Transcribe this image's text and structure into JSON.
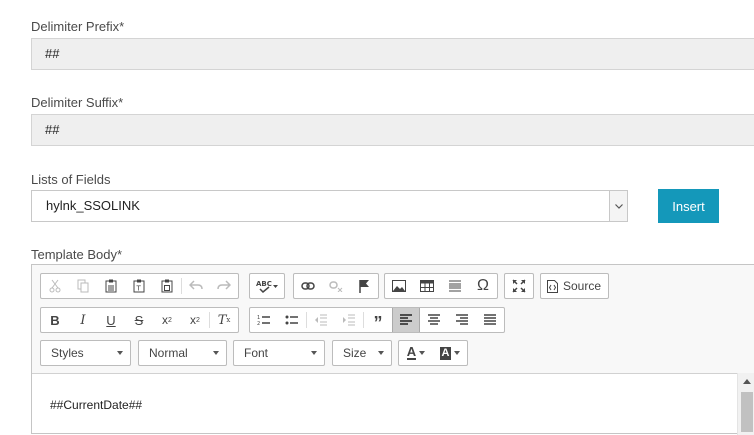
{
  "form": {
    "delimiter_prefix": {
      "label": "Delimiter Prefix*",
      "value": "##"
    },
    "delimiter_suffix": {
      "label": "Delimiter Suffix*",
      "value": "##"
    },
    "fields_list": {
      "label": "Lists of Fields",
      "selected": "hylnk_SSOLINK"
    },
    "insert_label": "Insert",
    "template_body": {
      "label": "Template Body*"
    }
  },
  "toolbar": {
    "source_label": "Source",
    "icons_row1": [
      "cut-icon",
      "copy-icon",
      "paste-icon",
      "paste-text-icon",
      "paste-word-icon",
      "undo-icon",
      "redo-icon",
      "spellcheck-icon",
      "link-icon",
      "unlink-icon",
      "anchor-icon",
      "image-icon",
      "table-icon",
      "horizontal-rule-icon",
      "special-char-icon",
      "maximize-icon",
      "source-icon"
    ],
    "icons_row2": [
      "bold-icon",
      "italic-icon",
      "underline-icon",
      "strikethrough-icon",
      "subscript-icon",
      "superscript-icon",
      "remove-format-icon",
      "numbered-list-icon",
      "bulleted-list-icon",
      "outdent-icon",
      "indent-icon",
      "blockquote-icon",
      "align-left-icon",
      "align-center-icon",
      "align-right-icon",
      "justify-icon"
    ],
    "styles_label": "Styles",
    "format_label": "Normal",
    "font_label": "Font",
    "size_label": "Size",
    "text_color_glyph": "A",
    "bg_color_glyph": "A"
  },
  "editor": {
    "content": "##CurrentDate##"
  },
  "colors": {
    "accent": "#1498ba",
    "field_bg": "#efefef"
  }
}
